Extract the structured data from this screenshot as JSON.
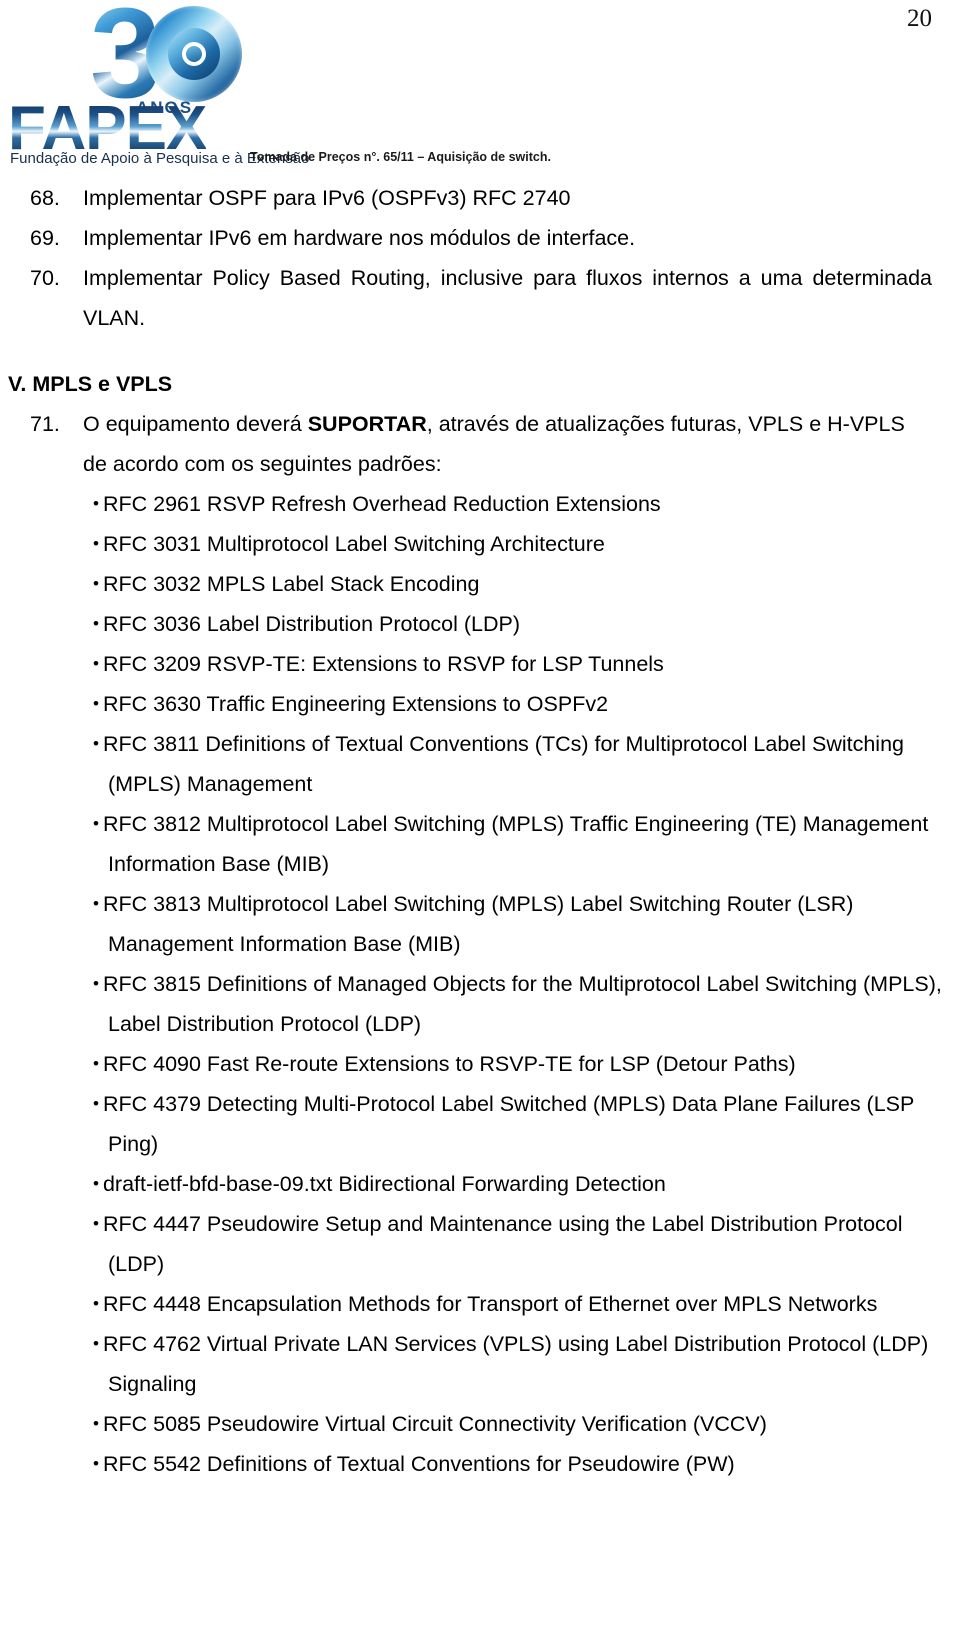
{
  "page": {
    "number": "20"
  },
  "header": {
    "logo": {
      "digits": "30",
      "anos_label": "ANOS",
      "wordmark": "FAPEX",
      "tagline": "Fundação de Apoio à Pesquisa e à Extensão",
      "brand_color": "#1d5f9c"
    },
    "document_note": "Tomada de Preços n°. 65/11 – Aquisição de switch."
  },
  "main": {
    "numbered_items": [
      {
        "number": "68.",
        "text": "Implementar OSPF para IPv6 (OSPFv3) RFC 2740"
      },
      {
        "number": "69.",
        "text": "Implementar IPv6 em hardware nos módulos de interface."
      },
      {
        "number": "70.",
        "text": "Implementar Policy Based Routing, inclusive para fluxos internos a uma determinada VLAN."
      }
    ],
    "section": {
      "label": "V. MPLS e VPLS"
    },
    "item_71": {
      "number": "71.",
      "text_before_bold": "O equipamento deverá ",
      "bold_text": "SUPORTAR",
      "text_after_bold": ", através de atualizações futuras, VPLS e H-VPLS de acordo com os seguintes padrões:"
    },
    "rfc_bullets": [
      "RFC 2961 RSVP Refresh Overhead Reduction Extensions",
      "RFC 3031 Multiprotocol Label Switching Architecture",
      "RFC 3032 MPLS Label Stack Encoding",
      "RFC 3036 Label Distribution Protocol (LDP)",
      "RFC 3209 RSVP-TE: Extensions to RSVP for LSP Tunnels",
      "RFC 3630 Traffic Engineering Extensions to OSPFv2",
      "RFC 3811 Definitions of Textual Conventions (TCs) for Multiprotocol Label Switching (MPLS) Management",
      "RFC 3812 Multiprotocol Label Switching (MPLS) Traffic Engineering (TE) Management Information Base (MIB)",
      "RFC 3813 Multiprotocol Label Switching (MPLS) Label Switching Router (LSR) Management Information Base (MIB)",
      "RFC 3815 Definitions of Managed Objects for the Multiprotocol Label Switching (MPLS), Label Distribution Protocol (LDP)",
      "RFC 4090 Fast Re-route Extensions to RSVP-TE for LSP (Detour Paths)",
      "RFC 4379 Detecting Multi-Protocol Label Switched (MPLS) Data Plane Failures (LSP Ping)",
      "draft-ietf-bfd-base-09.txt Bidirectional Forwarding Detection",
      "RFC 4447 Pseudowire Setup and Maintenance using the Label Distribution Protocol (LDP)",
      "RFC 4448 Encapsulation Methods for Transport of Ethernet over MPLS Networks",
      "RFC 4762 Virtual Private LAN Services (VPLS) using Label Distribution Protocol (LDP) Signaling",
      "RFC 5085 Pseudowire Virtual Circuit Connectivity Verification (VCCV)",
      "RFC 5542 Definitions of Textual Conventions for Pseudowire (PW)"
    ],
    "bullet_glyph": "•"
  }
}
